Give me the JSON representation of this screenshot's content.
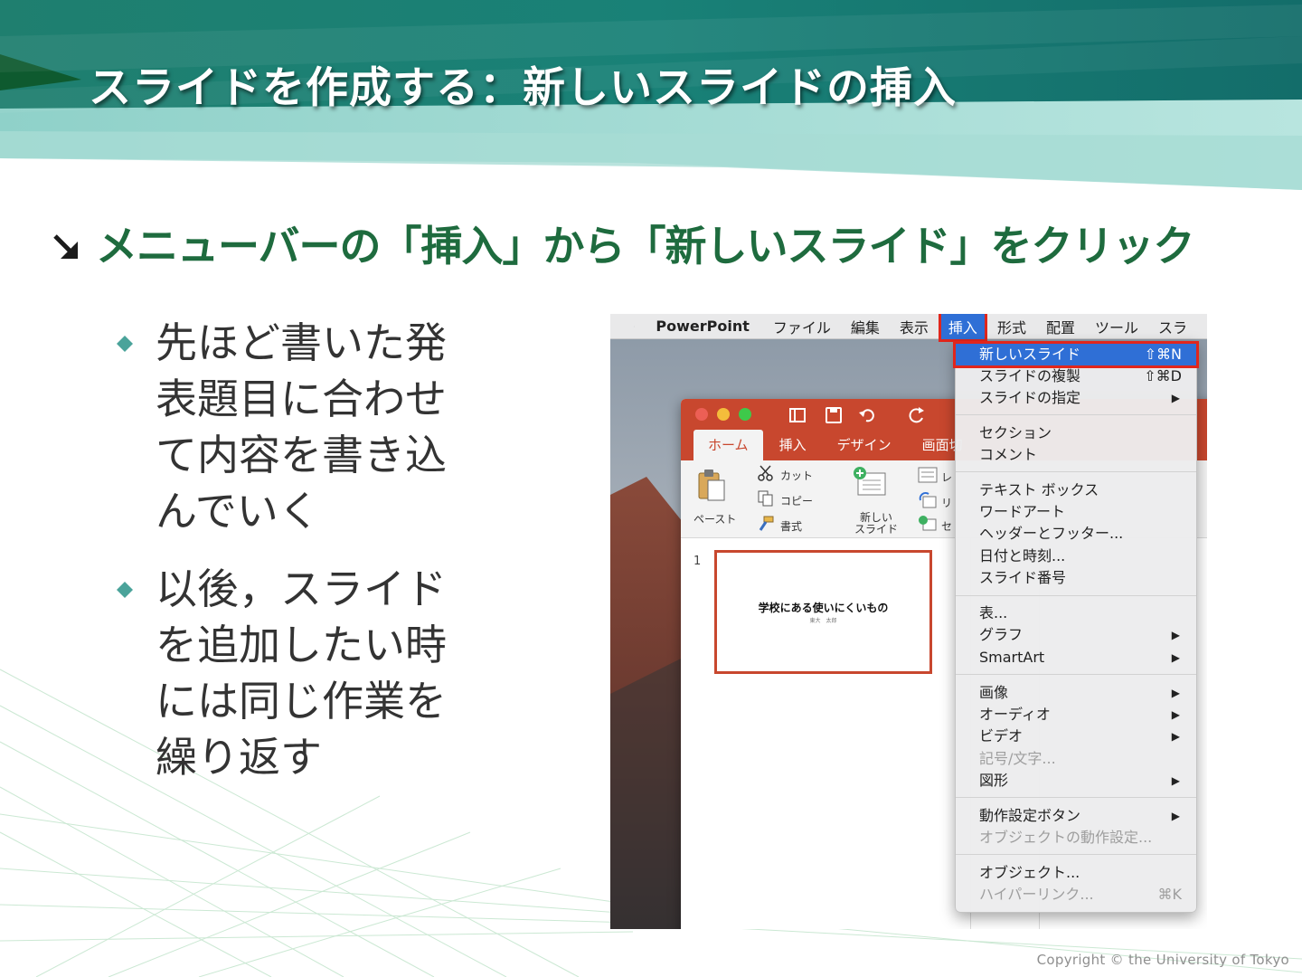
{
  "slide": {
    "title": "スライドを作成する：新しいスライドの挿入",
    "heading": "メニューバーの「挿入」から「新しいスライド」をクリック",
    "bullets": [
      "先ほど書いた発表題目に合わせて内容を書き込んでいく",
      "以後，スライドを追加したい時には同じ作業を繰り返す"
    ],
    "copyright": "Copyright © the University of Tokyo",
    "colors": {
      "title_band": "#1b7a73",
      "heading": "#1e6b3e",
      "bullet_mark": "#4aa39a",
      "highlight": "#e1261c",
      "menu_selection": "#2f6fd6",
      "app_accent": "#c8472e"
    }
  },
  "menubar": {
    "apple_icon": "apple-icon",
    "app_name": "PowerPoint",
    "items": [
      "ファイル",
      "編集",
      "表示",
      "挿入",
      "形式",
      "配置",
      "ツール",
      "スラ"
    ]
  },
  "app_window": {
    "tabs": [
      "ホーム",
      "挿入",
      "デザイン",
      "画面切"
    ],
    "ribbon": {
      "paste": "ペースト",
      "cut": "カット",
      "copy": "コピー",
      "format": "書式",
      "new_slide_line1": "新しい",
      "new_slide_line2": "スライド",
      "layout_partial": "レ",
      "reset_partial": "リ",
      "section_partial": "セ"
    },
    "thumbnail": {
      "number": "1",
      "title": "学校にある使いにくいもの",
      "subtitle": "東大　太郎"
    }
  },
  "insert_menu": {
    "items": [
      {
        "label": "新しいスライド",
        "shortcut": "⇧⌘N",
        "highlighted": true
      },
      {
        "label": "スライドの複製",
        "shortcut": "⇧⌘D"
      },
      {
        "label": "スライドの指定",
        "submenu": "▶"
      },
      {
        "label": "セクション"
      },
      {
        "label": "コメント"
      },
      {
        "label": "テキスト ボックス"
      },
      {
        "label": "ワードアート"
      },
      {
        "label": "ヘッダーとフッター..."
      },
      {
        "label": "日付と時刻..."
      },
      {
        "label": "スライド番号"
      },
      {
        "label": "表..."
      },
      {
        "label": "グラフ",
        "submenu": "▶"
      },
      {
        "label": "SmartArt",
        "submenu": "▶"
      },
      {
        "label": "画像",
        "submenu": "▶"
      },
      {
        "label": "オーディオ",
        "submenu": "▶"
      },
      {
        "label": "ビデオ",
        "submenu": "▶"
      },
      {
        "label": "記号/文字...",
        "disabled": true
      },
      {
        "label": "図形",
        "submenu": "▶"
      },
      {
        "label": "動作設定ボタン",
        "submenu": "▶"
      },
      {
        "label": "オブジェクトの動作設定...",
        "disabled": true
      },
      {
        "label": "オブジェクト..."
      },
      {
        "label": "ハイパーリンク...",
        "shortcut": "⌘K",
        "disabled": true
      }
    ]
  }
}
